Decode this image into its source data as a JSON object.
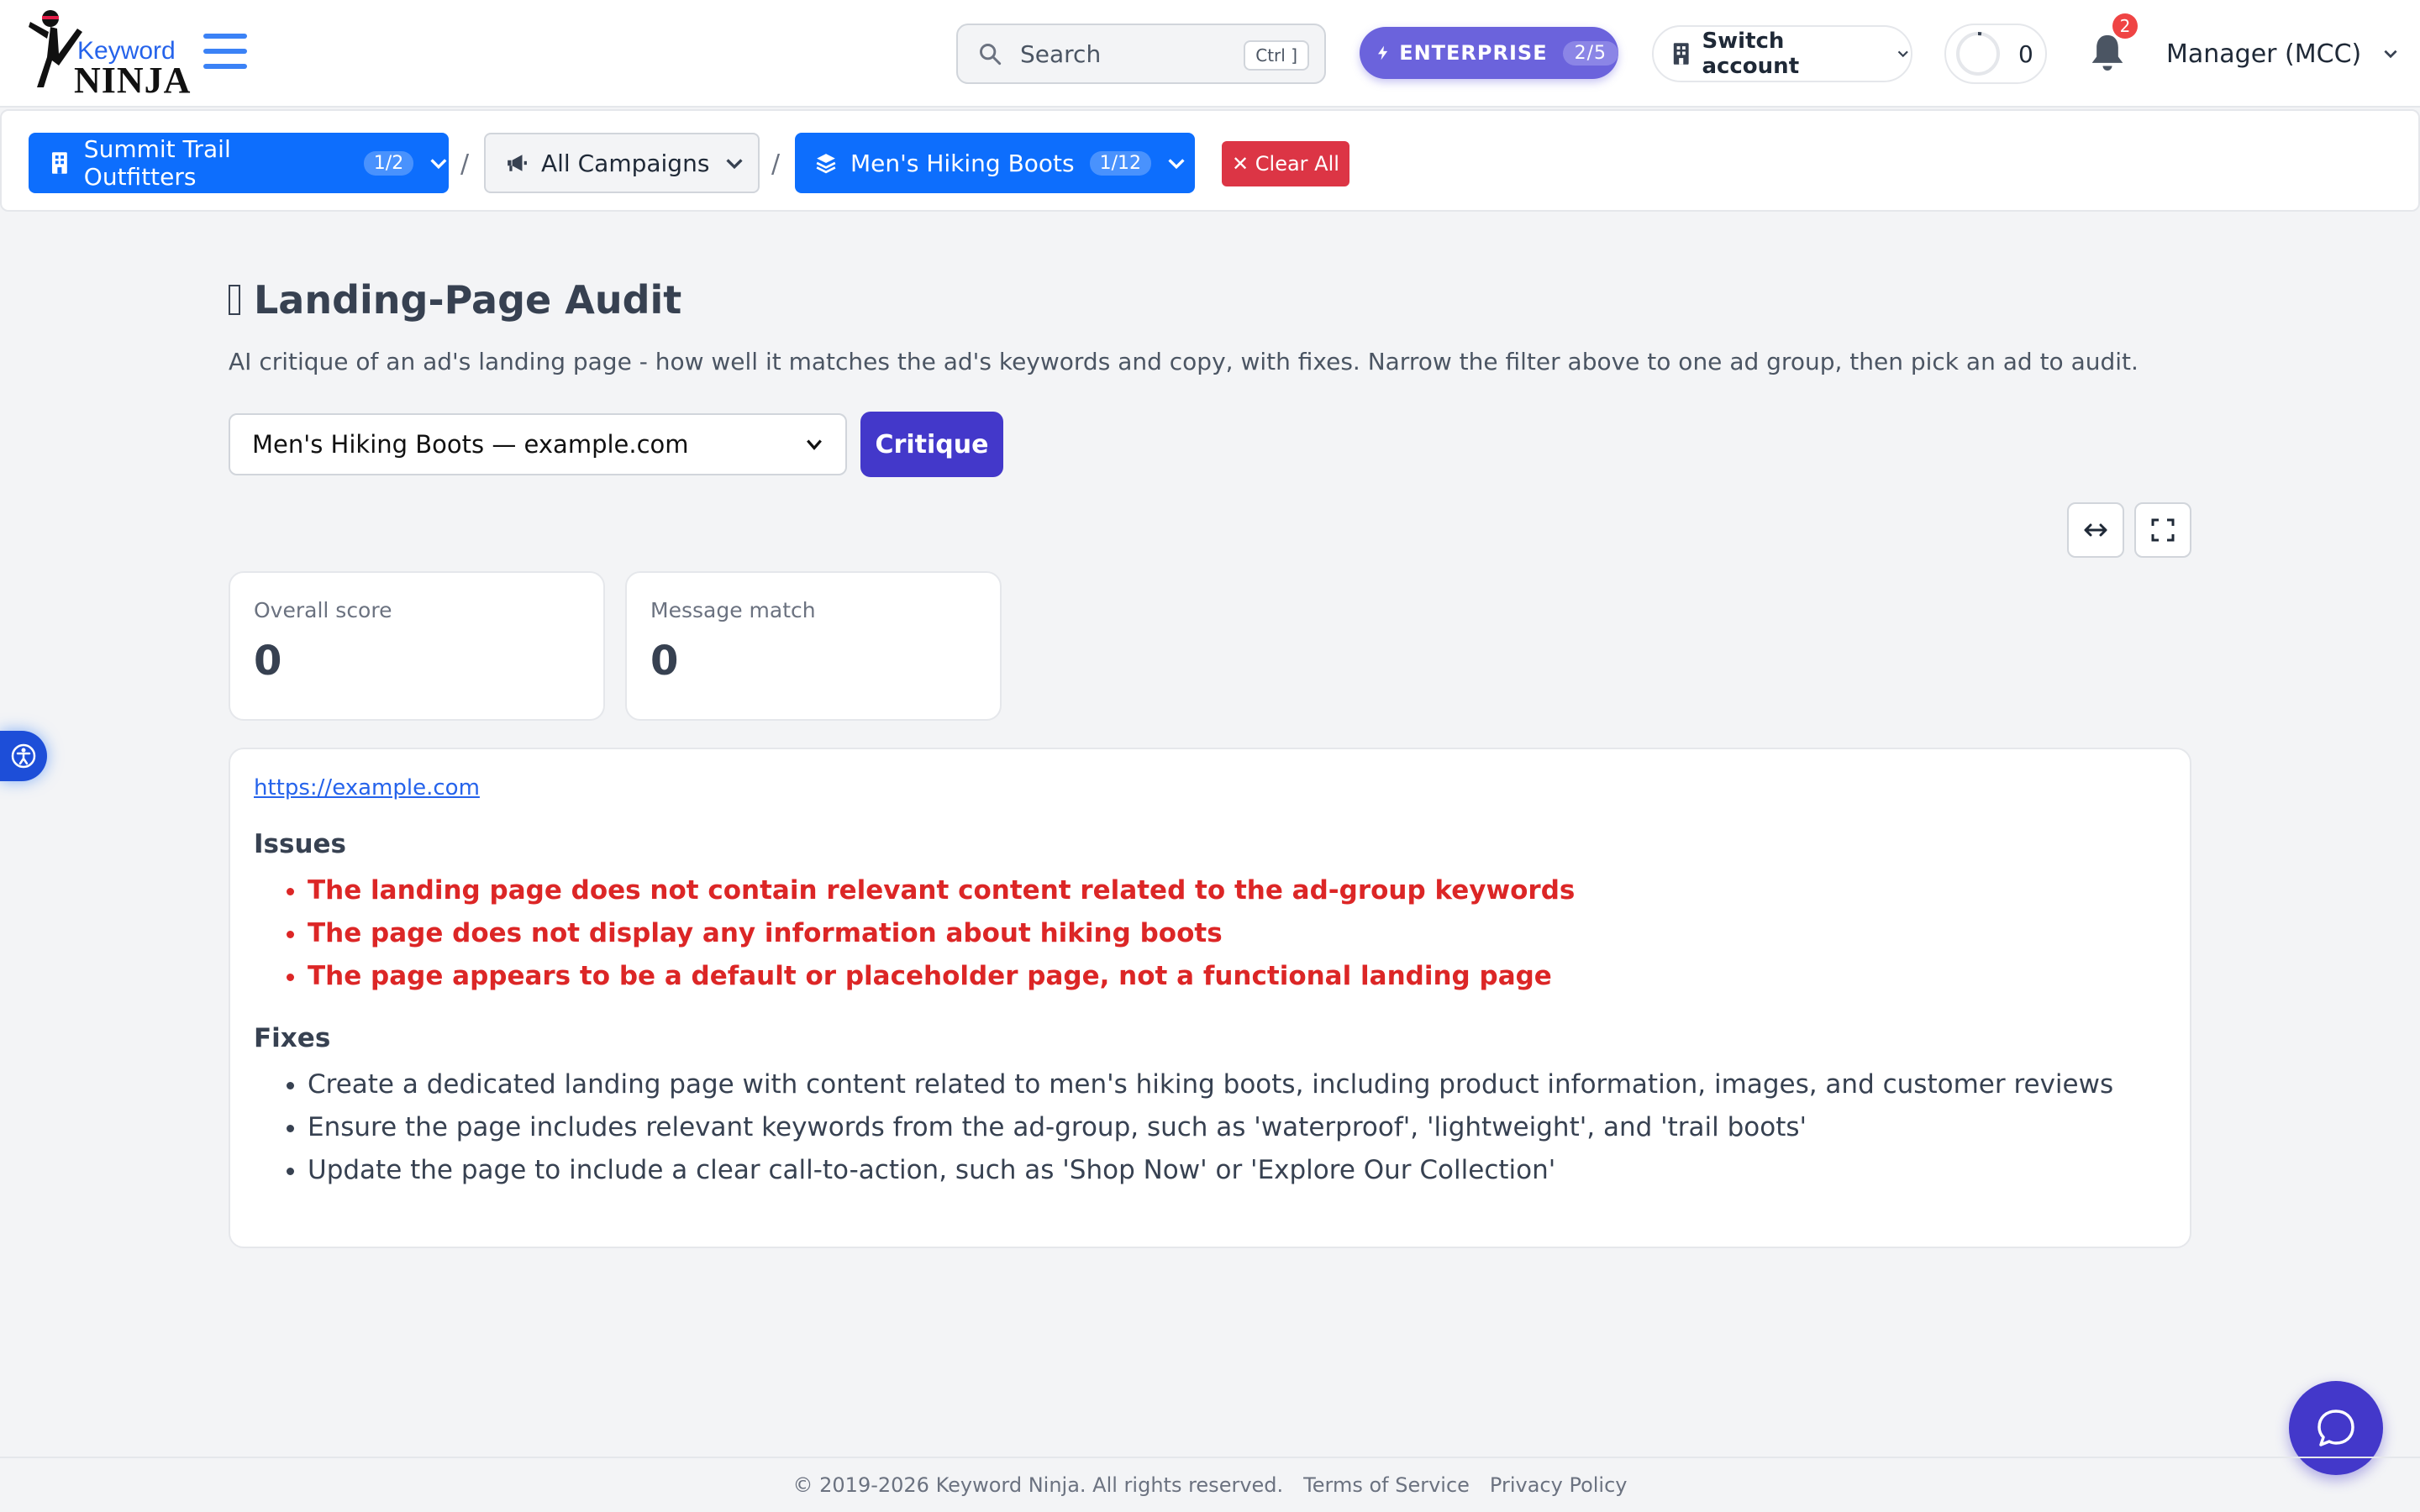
{
  "brand": {
    "logo_line1": "Keyword",
    "logo_line2": "NINJA"
  },
  "header": {
    "search_placeholder": "Search",
    "search_shortcut": "Ctrl ]",
    "plan_label": "ENTERPRISE",
    "plan_count": "2/5",
    "switch_account_label": "Switch account",
    "progress_value": "0",
    "notification_count": "2",
    "user_label": "Manager (MCC)"
  },
  "breadcrumb": {
    "account": {
      "label": "Summit Trail Outfitters",
      "count": "1/2"
    },
    "campaign": {
      "label": "All Campaigns"
    },
    "ad_group": {
      "label": "Men's Hiking Boots",
      "count": "1/12"
    },
    "separator": "/",
    "clear_label": "✕ Clear All"
  },
  "main": {
    "title": "Landing-Page Audit",
    "subtitle": "AI critique of an ad's landing page - how well it matches the ad's keywords and copy, with fixes. Narrow the filter above to one ad group, then pick an ad to audit.",
    "selected_ad": "Men's Hiking Boots — example.com",
    "critique_label": "Critique",
    "stats": [
      {
        "label": "Overall score",
        "value": "0"
      },
      {
        "label": "Message match",
        "value": "0"
      }
    ],
    "result": {
      "url": "https://example.com",
      "issues_heading": "Issues",
      "issues": [
        "The landing page does not contain relevant content related to the ad-group keywords",
        "The page does not display any information about hiking boots",
        "The page appears to be a default or placeholder page, not a functional landing page"
      ],
      "fixes_heading": "Fixes",
      "fixes": [
        "Create a dedicated landing page with content related to men's hiking boots, including product information, images, and customer reviews",
        "Ensure the page includes relevant keywords from the ad-group, such as 'waterproof', 'lightweight', and 'trail boots'",
        "Update the page to include a clear call-to-action, such as 'Shop Now' or 'Explore Our Collection'"
      ]
    }
  },
  "footer": {
    "copyright": "© 2019-2026 Keyword Ninja. All rights reserved.",
    "terms": "Terms of Service",
    "privacy": "Privacy Policy"
  },
  "colors": {
    "primary": "#0d6efd",
    "accent": "#4338ca",
    "danger": "#dc3545",
    "issue_text": "#dc2626"
  }
}
